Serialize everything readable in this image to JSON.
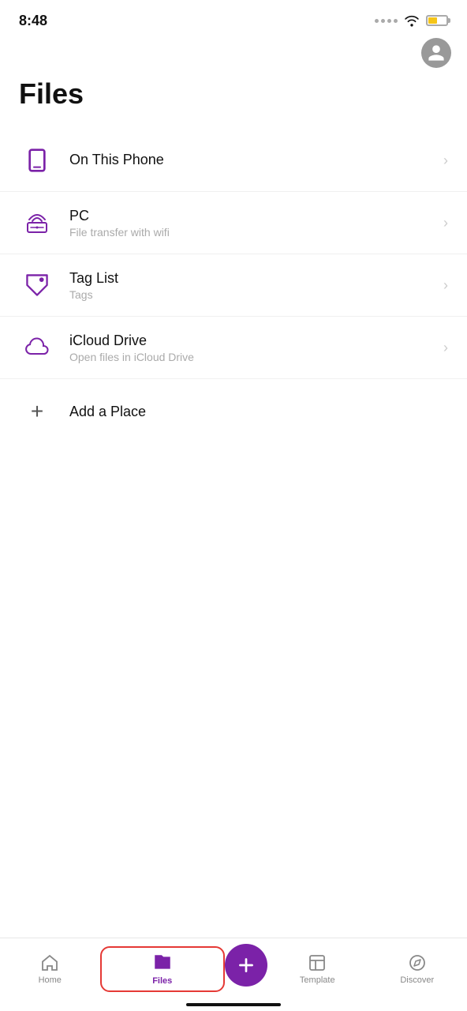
{
  "statusBar": {
    "time": "8:48"
  },
  "header": {
    "title": "Files"
  },
  "listItems": [
    {
      "id": "on-this-phone",
      "title": "On This Phone",
      "subtitle": "",
      "iconType": "phone"
    },
    {
      "id": "pc",
      "title": "PC",
      "subtitle": "File transfer with wifi",
      "iconType": "wifi-router"
    },
    {
      "id": "tag-list",
      "title": "Tag List",
      "subtitle": "Tags",
      "iconType": "tag"
    },
    {
      "id": "icloud-drive",
      "title": "iCloud Drive",
      "subtitle": "Open files in iCloud Drive",
      "iconType": "cloud"
    }
  ],
  "addPlace": {
    "label": "Add a Place"
  },
  "bottomNav": {
    "items": [
      {
        "id": "home",
        "label": "Home",
        "active": false
      },
      {
        "id": "files",
        "label": "Files",
        "active": true
      },
      {
        "id": "center",
        "label": "",
        "active": false
      },
      {
        "id": "template",
        "label": "Template",
        "active": false
      },
      {
        "id": "discover",
        "label": "Discover",
        "active": false
      }
    ]
  }
}
